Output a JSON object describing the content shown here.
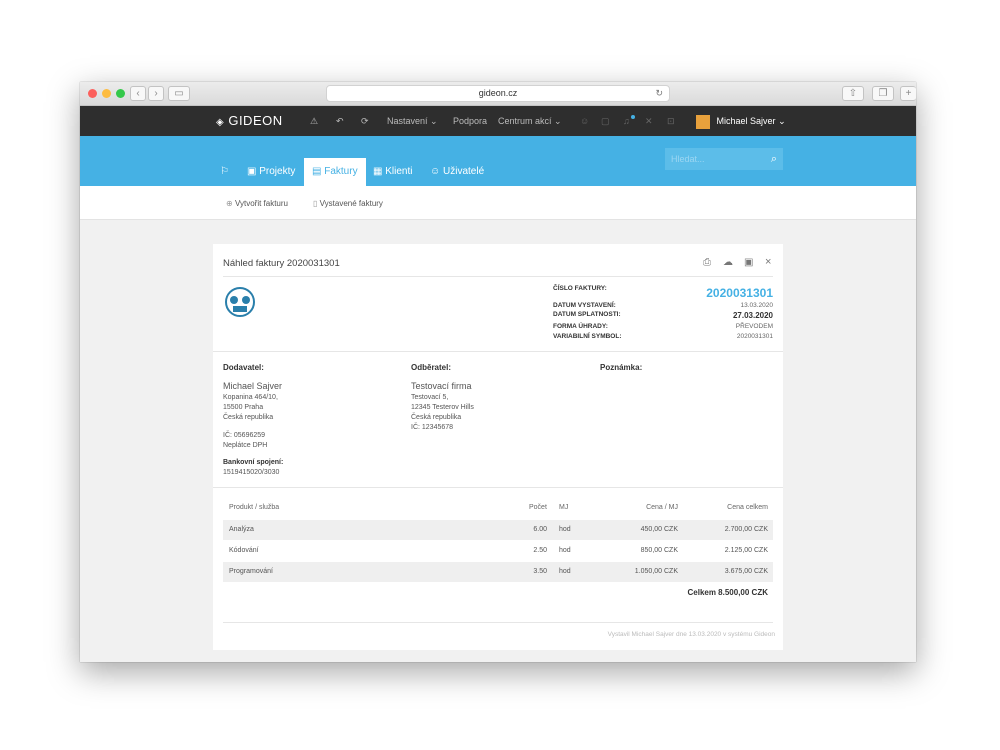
{
  "browser": {
    "url": "gideon.cz",
    "reload_icon": "reload-icon"
  },
  "app": {
    "brand": "GIDEON",
    "menu": {
      "settings": "Nastavení",
      "support": "Podpora",
      "actions": "Centrum akcí"
    },
    "user": "Michael Sajver",
    "tabs": {
      "projects": "Projekty",
      "invoices": "Faktury",
      "clients": "Klienti",
      "users": "Uživatelé"
    },
    "search_placeholder": "Hledat...",
    "sub": {
      "create": "Vytvořit fakturu",
      "issued": "Vystavené faktury"
    },
    "accent": "#45b1e4"
  },
  "invoice": {
    "title": "Náhled faktury 2020031301",
    "number_label": "ČÍSLO FAKTURY:",
    "number": "2020031301",
    "issued_label": "DATUM VYSTAVENÍ:",
    "issued": "13.03.2020",
    "due_label": "DATUM SPLATNOSTI:",
    "due": "27.03.2020",
    "payment_label": "FORMA ÚHRADY:",
    "payment": "PŘEVODEM",
    "vs_label": "VARIABILNÍ SYMBOL:",
    "vs": "2020031301",
    "supplier": {
      "heading": "Dodavatel:",
      "name": "Michael Sajver",
      "street": "Kopanina 464/10,",
      "city": "15500 Praha",
      "country": "Česká republika",
      "ic": "IČ: 05696259",
      "vat": "Neplátce DPH",
      "bank_heading": "Bankovní spojení:",
      "bank": "1519415020/3030"
    },
    "customer": {
      "heading": "Odběratel:",
      "name": "Testovací firma",
      "street": "Testovací 5,",
      "city": "12345 Testerov Hills",
      "country": "Česká republika",
      "ic": "IČ: 12345678"
    },
    "note_heading": "Poznámka:",
    "table": {
      "headers": [
        "Produkt / služba",
        "Počet",
        "MJ",
        "Cena / MJ",
        "Cena celkem"
      ],
      "rows": [
        [
          "Analýza",
          "6.00",
          "hod",
          "450,00 CZK",
          "2.700,00 CZK"
        ],
        [
          "Kódování",
          "2.50",
          "hod",
          "850,00 CZK",
          "2.125,00 CZK"
        ],
        [
          "Programování",
          "3.50",
          "hod",
          "1.050,00 CZK",
          "3.675,00 CZK"
        ]
      ]
    },
    "total": "Celkem 8.500,00 CZK",
    "footer": "Vystavil Michael Sajver dne 13.03.2020 v systému Gideon"
  }
}
